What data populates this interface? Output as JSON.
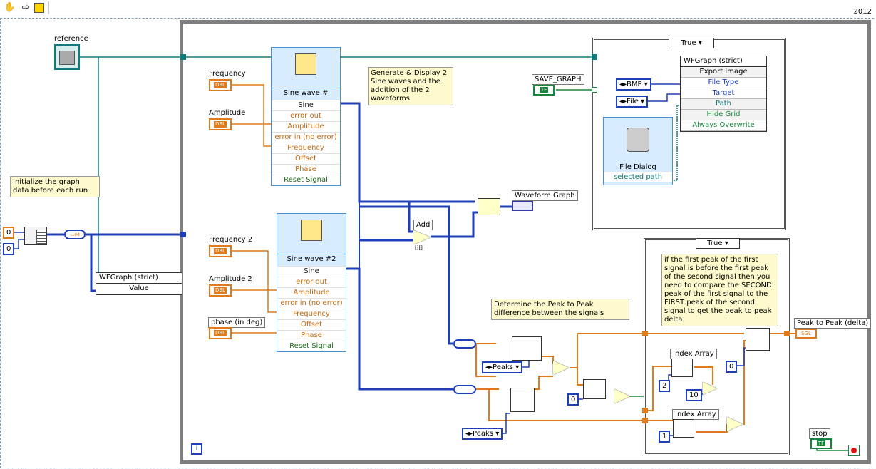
{
  "toolbar": {
    "year": "2012"
  },
  "labels": {
    "reference": "reference",
    "frequency": "Frequency",
    "amplitude": "Amplitude",
    "frequency2": "Frequency 2",
    "amplitude2": "Amplitude 2",
    "phase": "phase (in deg)",
    "save_graph": "SAVE_GRAPH",
    "waveform_graph": "Waveform Graph",
    "add": "Add",
    "index_array_1": "Index Array",
    "index_array_2": "Index Array",
    "peak_to_peak": "Peak to Peak (delta)",
    "stop": "stop"
  },
  "notes": {
    "init": "Initialize the graph data before each run",
    "generate": "Generate & Display 2 Sine waves and the addition of the 2 waveforms",
    "peak": "Determine the Peak to Peak difference between the signals",
    "first_peak": "if the first peak of the first signal is before the first peak of the second signal then you need to compare the SECOND peak of the first signal to the FIRST peak of the second signal to get the peak to peak delta"
  },
  "terminals": {
    "dbl": "DBL",
    "tf": "TF",
    "sgl": "SGL"
  },
  "constants": {
    "zero_a": "0",
    "zero_b": "0",
    "zero_c": "0",
    "zero_d": "0",
    "two": "2",
    "ten": "10",
    "one": "1"
  },
  "sine1": {
    "title": "Sine wave #",
    "rows": [
      "Sine",
      "error out",
      "Amplitude",
      "error in (no error)",
      "Frequency",
      "Offset",
      "Phase",
      "Reset Signal"
    ]
  },
  "sine2": {
    "title": "Sine wave #2",
    "rows": [
      "Sine",
      "error out",
      "Amplitude",
      "error in (no error)",
      "Frequency",
      "Offset",
      "Phase",
      "Reset Signal"
    ]
  },
  "case1": {
    "selector": "True"
  },
  "case2": {
    "selector": "True"
  },
  "export_node": {
    "header": "WFGraph (strict)",
    "rows": [
      "Export Image",
      "File Type",
      "Target",
      "Path",
      "Hide Grid",
      "Always Overwrite"
    ]
  },
  "value_node": {
    "header": "WFGraph (strict)",
    "row": "Value"
  },
  "enums": {
    "bmp": "BMP",
    "file": "File",
    "peaks1": "Peaks",
    "peaks2": "Peaks"
  },
  "file_dialog": {
    "title": "File Dialog",
    "row": "selected path"
  },
  "colors": {
    "orange": "#e07a1a",
    "blue": "#1f3fb8",
    "green": "#17853b",
    "teal": "#127a7a",
    "border": "#7f7f7f"
  }
}
